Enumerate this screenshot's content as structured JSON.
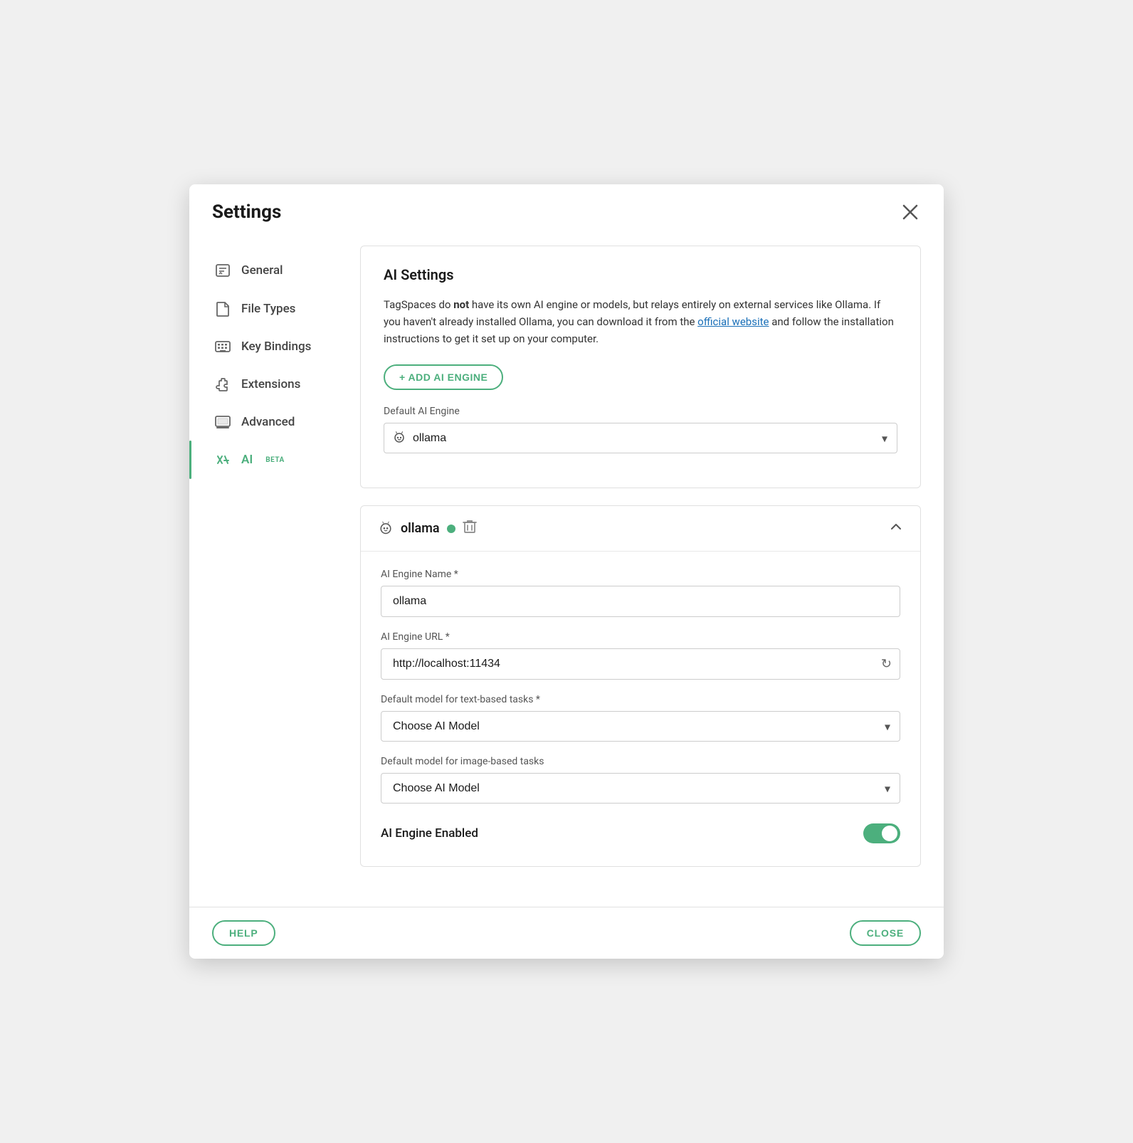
{
  "modal": {
    "title": "Settings",
    "close_label": "×"
  },
  "sidebar": {
    "items": [
      {
        "id": "general",
        "label": "General",
        "icon": "checklist"
      },
      {
        "id": "file-types",
        "label": "File Types",
        "icon": "file"
      },
      {
        "id": "key-bindings",
        "label": "Key Bindings",
        "icon": "keyboard"
      },
      {
        "id": "extensions",
        "label": "Extensions",
        "icon": "puzzle"
      },
      {
        "id": "advanced",
        "label": "Advanced",
        "icon": "monitor"
      },
      {
        "id": "ai",
        "label": "AI",
        "badge": "BETA",
        "icon": "ai"
      }
    ]
  },
  "ai_settings": {
    "section_title": "AI Settings",
    "description_part1": "TagSpaces do ",
    "description_bold": "not",
    "description_part2": " have its own AI engine or models, but relays entirely on external services like Ollama. If you haven't already installed Ollama, you can download it from the ",
    "description_link": "official website",
    "description_part3": " and follow the installation instructions to get it set up on your computer.",
    "add_engine_btn": "+ ADD AI ENGINE",
    "default_engine_label": "Default AI Engine",
    "default_engine_value": "ollama",
    "default_engine_icon": "🦙"
  },
  "engine_card": {
    "name": "ollama",
    "status": "active",
    "name_field_label": "AI Engine Name *",
    "name_field_value": "ollama",
    "url_field_label": "AI Engine URL *",
    "url_field_value": "http://localhost:11434",
    "text_model_label": "Default model for text-based tasks *",
    "text_model_placeholder": "Choose AI Model",
    "image_model_label": "Default model for image-based tasks",
    "image_model_placeholder": "Choose AI Model",
    "enabled_label": "AI Engine Enabled",
    "enabled": true
  },
  "footer": {
    "help_btn": "HELP",
    "close_btn": "CLOSE"
  }
}
